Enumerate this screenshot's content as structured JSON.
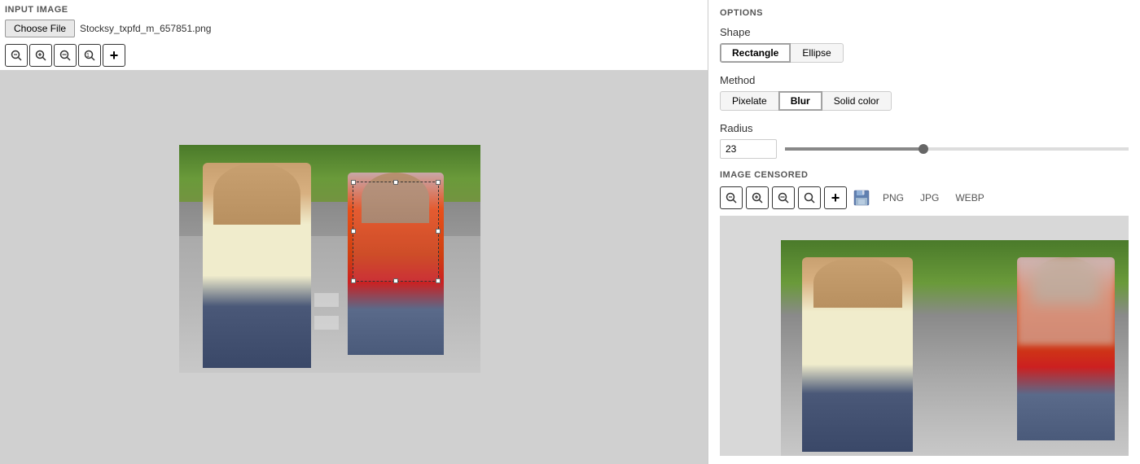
{
  "left_panel": {
    "input_label": "INPUT IMAGE",
    "choose_file_label": "Choose File",
    "filename": "Stocksy_txpfd_m_657851.png",
    "zoom_buttons": [
      {
        "id": "zoom-fit",
        "symbol": "🔍",
        "title": "Fit"
      },
      {
        "id": "zoom-in",
        "symbol": "🔍",
        "title": "Zoom In"
      },
      {
        "id": "zoom-out",
        "symbol": "🔍",
        "title": "Zoom Out"
      },
      {
        "id": "zoom-reset",
        "symbol": "🔍",
        "title": "Reset"
      },
      {
        "id": "zoom-add",
        "symbol": "+",
        "title": "Add"
      }
    ]
  },
  "right_panel": {
    "options_title": "OPTIONS",
    "shape": {
      "label": "Shape",
      "options": [
        "Rectangle",
        "Ellipse"
      ],
      "active": "Rectangle"
    },
    "method": {
      "label": "Method",
      "options": [
        "Pixelate",
        "Blur",
        "Solid color"
      ],
      "active": "Blur"
    },
    "radius": {
      "label": "Radius",
      "value": "23",
      "slider_pct": 40
    },
    "image_censored": {
      "label": "IMAGE CENSORED",
      "formats": [
        "PNG",
        "JPG",
        "WEBP"
      ]
    }
  }
}
